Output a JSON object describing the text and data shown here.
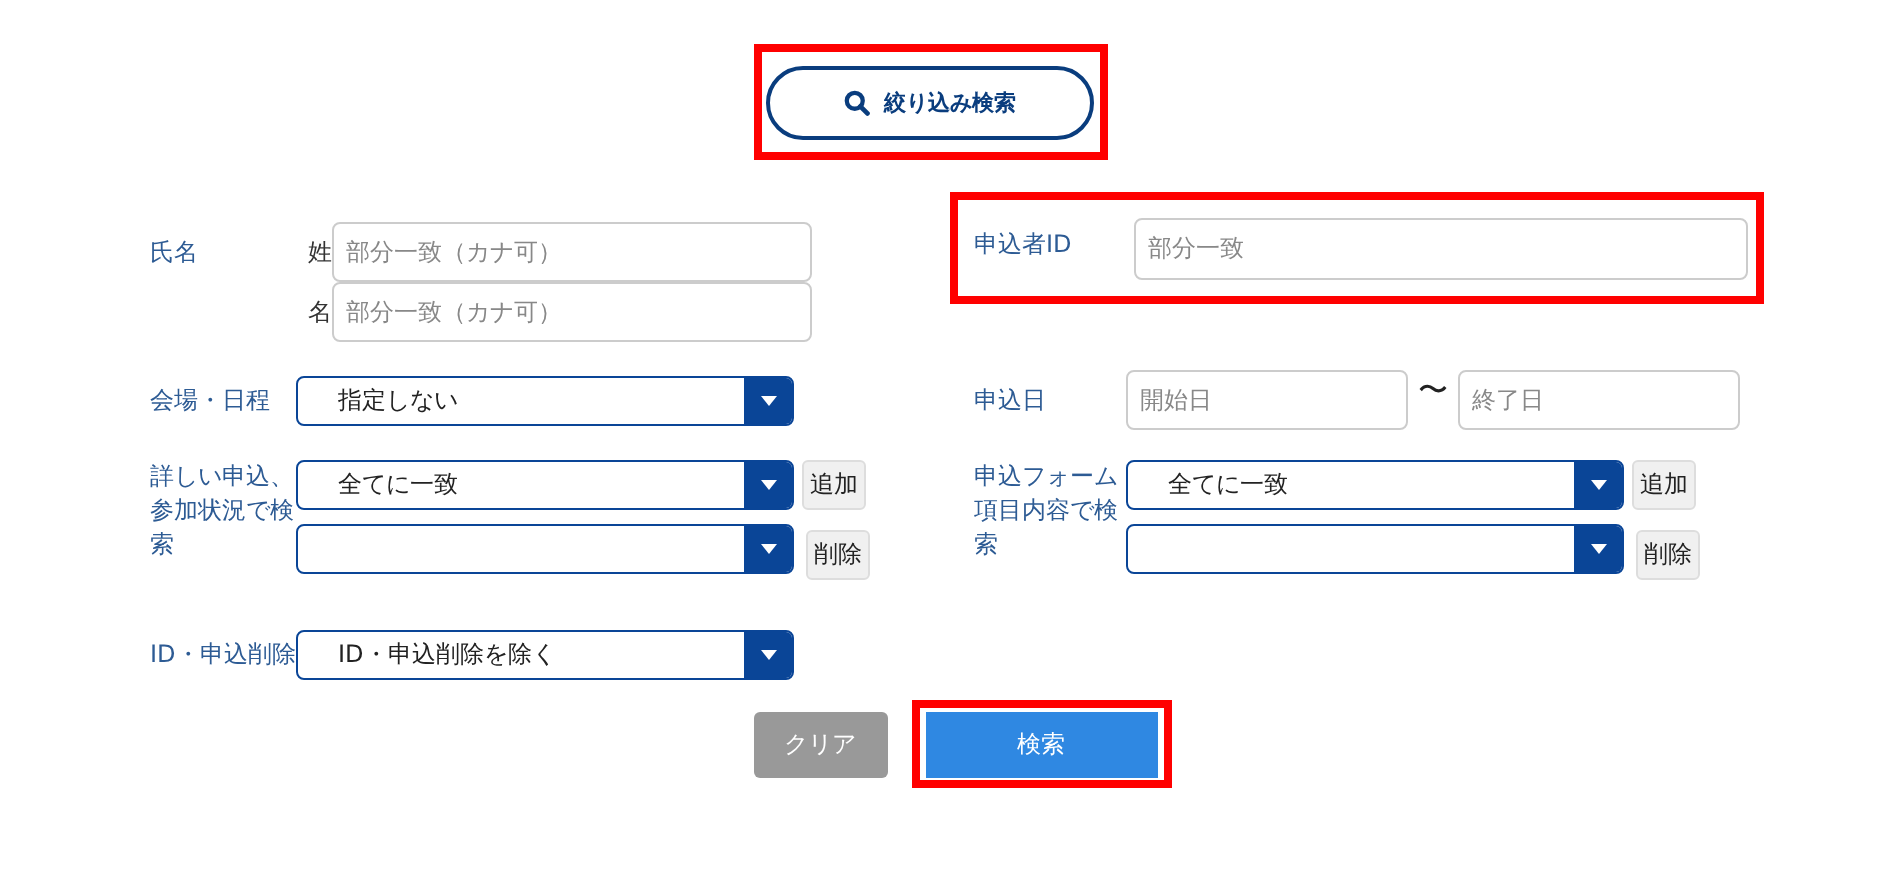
{
  "filter_toggle": {
    "label": "絞り込み検索",
    "highlighted": true
  },
  "name": {
    "label": "氏名",
    "fields": [
      {
        "label": "姓",
        "placeholder": "部分一致（カナ可）"
      },
      {
        "label": "名",
        "placeholder": "部分一致（カナ可）"
      }
    ]
  },
  "applicant_id": {
    "label": "申込者ID",
    "placeholder": "部分一致",
    "highlighted": true
  },
  "venue_schedule": {
    "label": "会場・日程",
    "value": "指定しない"
  },
  "application_date": {
    "label": "申込日",
    "start_placeholder": "開始日",
    "separator": "〜",
    "end_placeholder": "終了日"
  },
  "status_search": {
    "label": "詳しい申込、参加状況で検索",
    "selects": [
      {
        "kind": "chosen",
        "value": "全てに一致"
      },
      {
        "kind": "empty"
      }
    ],
    "add_button": "追加",
    "remove_button": "削除"
  },
  "form_item_search": {
    "label": "申込フォーム項目内容で検索",
    "selects": [
      {
        "kind": "chosen",
        "value": "全てに一致"
      },
      {
        "kind": "empty"
      }
    ],
    "add_button": "追加",
    "remove_button": "削除"
  },
  "id_deletion": {
    "label": "ID・申込削除",
    "value": "ID・申込削除を除く"
  },
  "buttons": [
    {
      "kind": "clear",
      "label": "クリア",
      "highlighted": false
    },
    {
      "kind": "search",
      "label": "検索",
      "highlighted": true
    }
  ]
}
